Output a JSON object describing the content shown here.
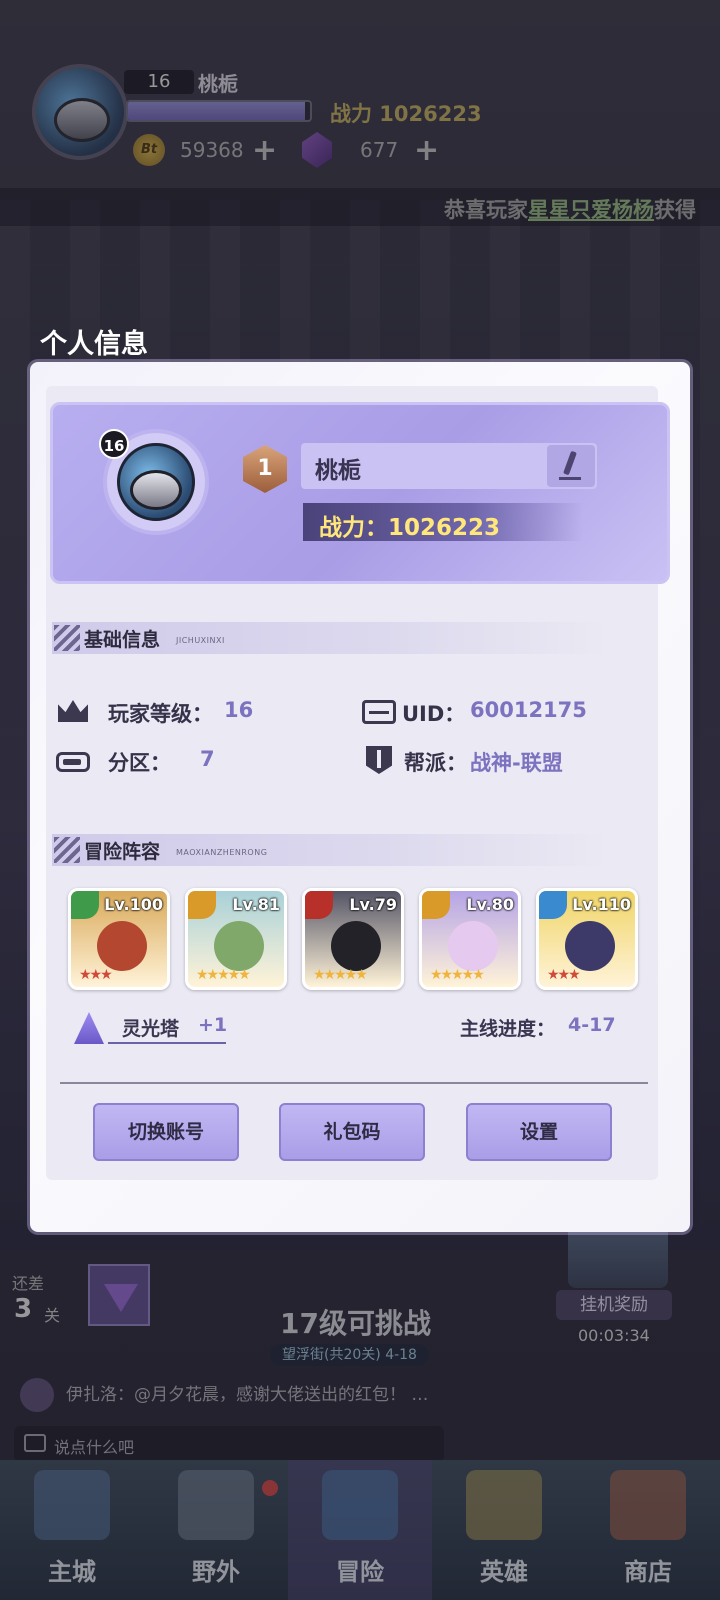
{
  "top_bar": {
    "level": "16",
    "player_name": "桃栀",
    "xp_fraction": 0.97,
    "power_label": "战力 1026223",
    "coins": "59368",
    "coin_icon_text": "Bt",
    "gems": "677",
    "plus_symbol": "+"
  },
  "ticker": {
    "prefix": "恭喜玩家",
    "player": "星星只爱杨杨",
    "suffix": "获得"
  },
  "modal": {
    "title": "个人信息",
    "profile": {
      "level_badge": "16",
      "rank": "1",
      "name": "桃栀",
      "power": "战力：1026223"
    },
    "basic_info": {
      "title": "基础信息",
      "subtitle": "JICHUXINXI",
      "level_label": "玩家等级：",
      "level_value": "16",
      "uid_label": "UID：",
      "uid_value": "60012175",
      "server_label": "分区：",
      "server_value": "7",
      "guild_label": "帮派：",
      "guild_value": "战神-联盟"
    },
    "lineup": {
      "title": "冒险阵容",
      "subtitle": "MAOXIANZHENRONG",
      "heroes": [
        {
          "level": "Lv.100",
          "element": "nature",
          "stars": "★★★",
          "star_color": "#d04a3a",
          "bg": "#d9a95a",
          "face": "#b3472f",
          "el_color": "#3f9a4a"
        },
        {
          "level": "Lv.81",
          "element": "light",
          "stars": "★★★★★",
          "star_color": "#f0b43a",
          "bg": "#a9d1d8",
          "face": "#7fa86a",
          "el_color": "#d99a2a"
        },
        {
          "level": "Lv.79",
          "element": "fire",
          "stars": "★★★★★",
          "star_color": "#f0b43a",
          "bg": "#545466",
          "face": "#222228",
          "el_color": "#b8302a"
        },
        {
          "level": "Lv.80",
          "element": "light",
          "stars": "★★★★★",
          "star_color": "#f0b43a",
          "bg": "#b5a4e6",
          "face": "#e6c9ee",
          "el_color": "#d99a2a"
        },
        {
          "level": "Lv.110",
          "element": "water",
          "stars": "★★★",
          "star_color": "#d04a3a",
          "bg": "#f0d567",
          "face": "#3d3a6a",
          "el_color": "#3a8ad0"
        }
      ],
      "tower_label": "灵光塔",
      "tower_value": "+1",
      "progress_label": "主线进度：",
      "progress_value": "4-17"
    },
    "buttons": {
      "switch_account": "切换账号",
      "gift_code": "礼包码",
      "settings": "设置"
    }
  },
  "bottom": {
    "remaining_label": "还差",
    "remaining_num": "3",
    "remaining_unit": "关",
    "challenge_text": "17级可挑战",
    "stage_sub": "望浮街(共20关) 4-18",
    "idle_reward": "挂机奖励",
    "idle_time": "00:03:34",
    "chat_message": "伊扎洛：@月夕花晨，感谢大佬送出的红包！ …",
    "chat_placeholder": "说点什么吧"
  },
  "nav": {
    "items": [
      {
        "label": "主城",
        "color": "#5f7ea8"
      },
      {
        "label": "野外",
        "color": "#7e8a9c"
      },
      {
        "label": "冒险",
        "color": "#4f7fb0"
      },
      {
        "label": "英雄",
        "color": "#b8a05a"
      },
      {
        "label": "商店",
        "color": "#b86a4a"
      }
    ]
  }
}
